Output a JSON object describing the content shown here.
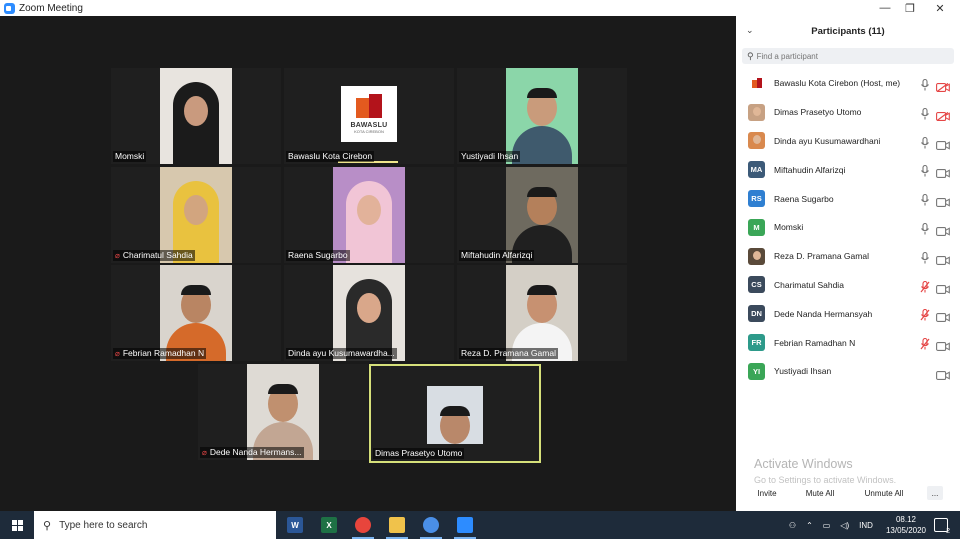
{
  "window": {
    "title": "Zoom Meeting",
    "minimize": "—",
    "maximize": "❐",
    "close": "✕"
  },
  "gallery": {
    "tiles": [
      {
        "name": "Momski",
        "muted": false,
        "video": "hijab-dark"
      },
      {
        "name": "Bawaslu Kota Cirebon",
        "muted": false,
        "video": "logo",
        "speaking": true
      },
      {
        "name": "Yustiyadi Ihsan",
        "muted": false,
        "video": "man-green"
      },
      {
        "name": "Charimatul Sahdia",
        "muted": true,
        "video": "hijab-yellow"
      },
      {
        "name": "Raena Sugarbo",
        "muted": false,
        "video": "hijab-pink"
      },
      {
        "name": "Miftahudin Alfarizqi",
        "muted": false,
        "video": "man-dark"
      },
      {
        "name": "Febrian Ramadhan N",
        "muted": true,
        "video": "man-orange"
      },
      {
        "name": "Dinda ayu Kusumawardha...",
        "muted": false,
        "video": "hijab-black"
      },
      {
        "name": "Reza D. Pramana Gamal",
        "muted": false,
        "video": "man-white"
      },
      {
        "name": "Dede Nanda Hermans...",
        "muted": true,
        "video": "man-light"
      },
      {
        "name": "Dimas Prasetyo Utomo",
        "muted": false,
        "video": "man-blue",
        "active": true
      }
    ],
    "logo": {
      "text": "BAWASLU",
      "sub": "KOTA CIREBON"
    }
  },
  "participants": {
    "title": "Participants (11)",
    "search_placeholder": "Find a participant",
    "list": [
      {
        "name": "Bawaslu Kota Cirebon (Host, me)",
        "initials": "",
        "avatar_color": "#ffffff",
        "avatar_type": "logo",
        "mic": "on",
        "cam": "off"
      },
      {
        "name": "Dimas Prasetyo Utomo",
        "initials": "",
        "avatar_color": "#c7a183",
        "avatar_type": "photo",
        "mic": "on",
        "cam": "off"
      },
      {
        "name": "Dinda ayu Kusumawardhani",
        "initials": "",
        "avatar_color": "#d9894e",
        "avatar_type": "photo",
        "mic": "on",
        "cam": "on"
      },
      {
        "name": "Miftahudin Alfarizqi",
        "initials": "MA",
        "avatar_color": "#3c5a78",
        "avatar_type": "initials",
        "mic": "on",
        "cam": "on"
      },
      {
        "name": "Raena Sugarbo",
        "initials": "RS",
        "avatar_color": "#2f7fd1",
        "avatar_type": "initials",
        "mic": "on",
        "cam": "on"
      },
      {
        "name": "Momski",
        "initials": "M",
        "avatar_color": "#3aa657",
        "avatar_type": "initials",
        "mic": "on",
        "cam": "on"
      },
      {
        "name": "Reza D. Pramana Gamal",
        "initials": "",
        "avatar_color": "#5a4a3a",
        "avatar_type": "photo",
        "mic": "on",
        "cam": "on"
      },
      {
        "name": "Charimatul Sahdia",
        "initials": "CS",
        "avatar_color": "#3b4a5c",
        "avatar_type": "initials",
        "mic": "muted",
        "cam": "on"
      },
      {
        "name": "Dede Nanda Hermansyah",
        "initials": "DN",
        "avatar_color": "#3b4a5c",
        "avatar_type": "initials",
        "mic": "muted",
        "cam": "on"
      },
      {
        "name": "Febrian Ramadhan N",
        "initials": "FR",
        "avatar_color": "#2d9a8a",
        "avatar_type": "initials",
        "mic": "muted",
        "cam": "on"
      },
      {
        "name": "Yustiyadi Ihsan",
        "initials": "YI",
        "avatar_color": "#3aa657",
        "avatar_type": "initials",
        "mic": "none",
        "cam": "on"
      }
    ],
    "watermark_title": "Activate Windows",
    "watermark_sub": "Go to Settings to activate Windows.",
    "buttons": {
      "invite": "Invite",
      "mute_all": "Mute All",
      "unmute_all": "Unmute All",
      "more": "..."
    }
  },
  "taskbar": {
    "search_placeholder": "Type here to search",
    "apps": [
      {
        "name": "word",
        "label": "W",
        "color": "#2b5797",
        "open": false
      },
      {
        "name": "excel",
        "label": "X",
        "color": "#1e7145",
        "open": false
      },
      {
        "name": "chrome",
        "label": "",
        "color": "#e8453c",
        "open": true
      },
      {
        "name": "file-explorer",
        "label": "",
        "color": "#f0c24b",
        "open": true
      },
      {
        "name": "chrome-alt",
        "label": "",
        "color": "#4a8fe7",
        "open": true
      },
      {
        "name": "zoom",
        "label": "",
        "color": "#2d8cff",
        "open": true
      }
    ],
    "language": "IND",
    "time": "08.12",
    "date": "13/05/2020",
    "notifications": "2"
  }
}
